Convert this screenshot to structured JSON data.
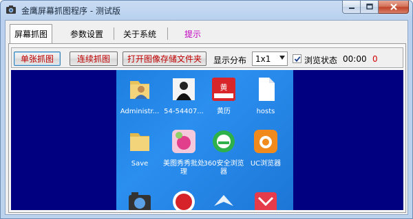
{
  "window": {
    "title": "金鹰屏幕抓图程序 - 测试版"
  },
  "tabs": [
    {
      "label": "屏幕抓图"
    },
    {
      "label": "参数设置"
    },
    {
      "label": "关于系统"
    },
    {
      "label": "提示"
    }
  ],
  "toolbar": {
    "single_capture": "单张抓图",
    "continuous_capture": "连续抓图",
    "open_folder": "打开图像存储文件夹",
    "display_layout_label": "显示分布",
    "display_layout_value": "1x1",
    "browse_state_label": "浏览状态",
    "browse_state_checked": true,
    "time": "00:00",
    "count": "0"
  },
  "desktop_icons": [
    {
      "label": "Administr...",
      "icon": "user-folder-icon"
    },
    {
      "label": "54-54407...",
      "icon": "person-photo-icon"
    },
    {
      "label": "黄历",
      "icon": "calendar-app-icon"
    },
    {
      "label": "hosts",
      "icon": "file-icon"
    },
    {
      "label": "Save",
      "icon": "folder-icon"
    },
    {
      "label": "美图秀秀批处理",
      "icon": "meitu-icon"
    },
    {
      "label": "360安全浏览器",
      "icon": "browser-360-icon"
    },
    {
      "label": "UC浏览器",
      "icon": "uc-browser-icon"
    },
    {
      "label": "",
      "icon": "camera-app-icon"
    },
    {
      "label": "",
      "icon": "red-app-icon"
    },
    {
      "label": "",
      "icon": "bird-app-icon"
    },
    {
      "label": "",
      "icon": "mail-app-icon"
    }
  ],
  "colors": {
    "preview_background": "#000080",
    "button_text": "#c00000",
    "hint_tab": "#c000c0"
  }
}
